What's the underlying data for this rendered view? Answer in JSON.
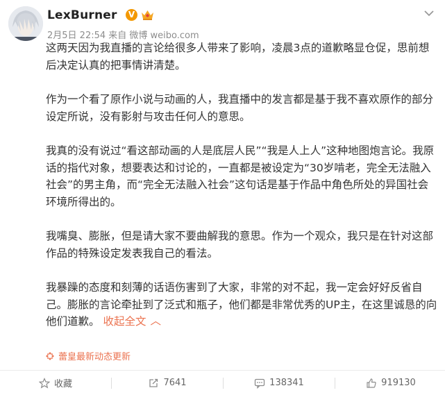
{
  "user": {
    "name": "LexBurner",
    "verified_badge": "V",
    "post_meta": "2月5日 22:54 来自 微博 weibo.com"
  },
  "post": {
    "paragraphs": [
      "这两天因为我直播的言论给很多人带来了影响，凌晨3点的道歉略显仓促，思前想后决定认真的把事情讲清楚。",
      "作为一个看了原作小说与动画的人，我直播中的发言都是基于我不喜欢原作的部分设定所说，没有影射与攻击任何人的意思。",
      "我真的没有说过“看这部动画的人是底层人民”“我是人上人”这种地图炮言论。我原话的指代对象，想要表达和讨论的，一直都是被设定为“30岁啃老，完全无法融入社会”的男主角，而“完全无法融入社会”这句话是基于作品中角色所处的异国社会环境所得出的。",
      "我嘴臭、膨胀，但是请大家不要曲解我的意思。作为一个观众，我只是在针对这部作品的特殊设定发表我自己的看法。",
      "我暴躁的态度和刻薄的话语伤害到了大家，非常的对不起，我一定会好好反省自己。膨胀的言论牵扯到了泛式和瓶子，他们都是非常优秀的UP主，在这里诚恳的向他们道歉。"
    ],
    "collapse_label": "收起全文",
    "collapse_arrow": "︿",
    "source_label": "蕾皇最新动态更新"
  },
  "footer": {
    "favorite_label": "收藏",
    "repost_count": "7641",
    "comment_count": "138341",
    "like_count": "919130"
  },
  "colors": {
    "accent": "#eb7350",
    "badge_orange": "#f39800",
    "meta_gray": "#8c8c8c"
  },
  "icons": [
    "more-chevron-icon",
    "verified-v-icon",
    "crown-badge-icon",
    "sparkle-icon",
    "star-icon",
    "repost-icon",
    "comment-icon",
    "thumbs-up-icon"
  ]
}
